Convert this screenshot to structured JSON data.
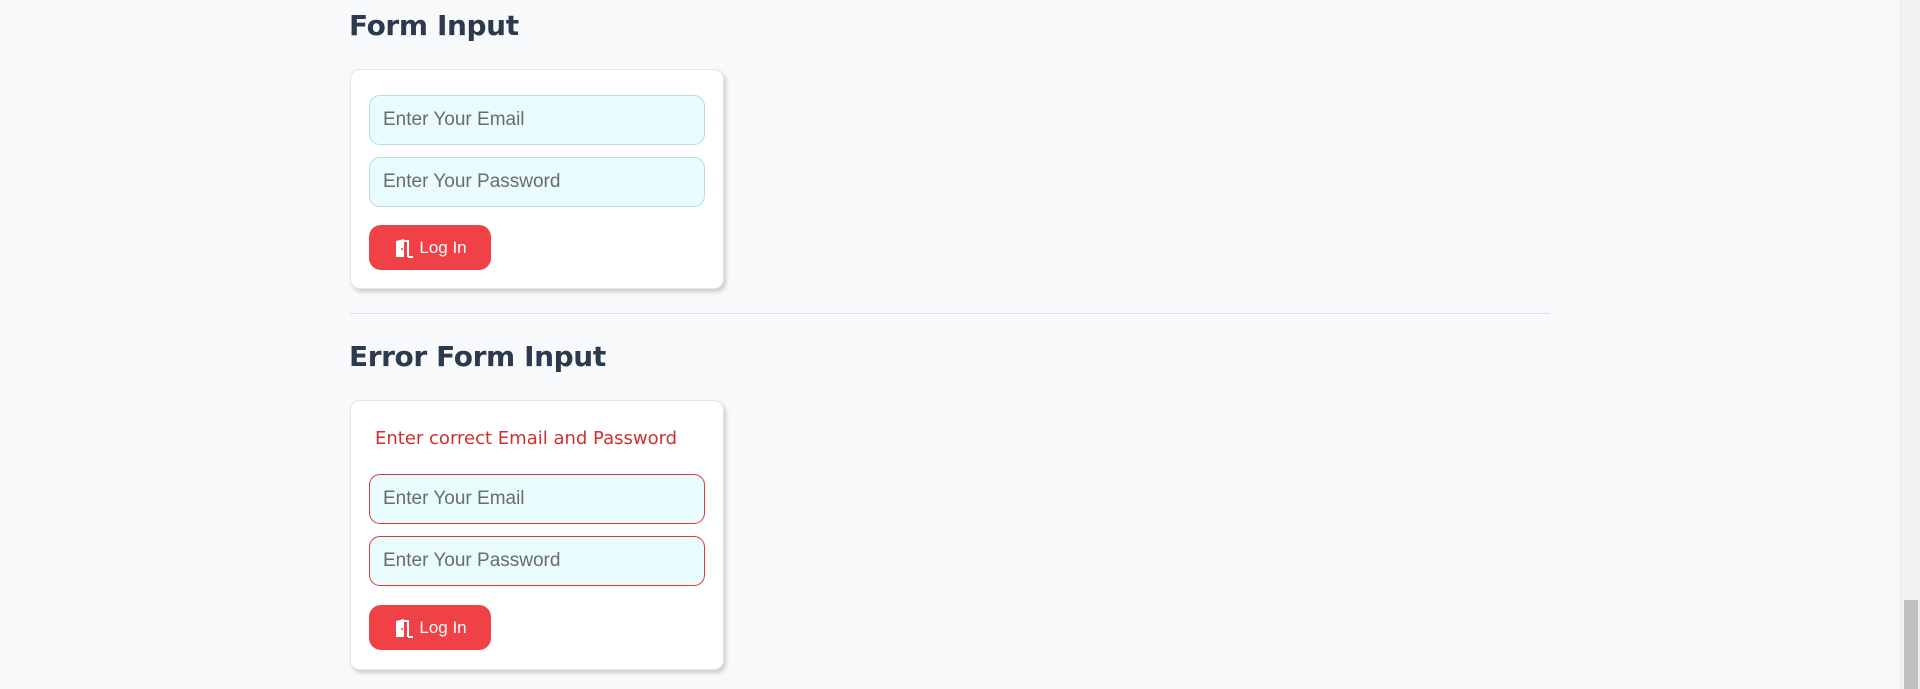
{
  "form_section": {
    "title": "Form Input",
    "email_placeholder": "Enter Your Email",
    "password_placeholder": "Enter Your Password",
    "login_label": "Log In",
    "login_icon": "door-exit-icon"
  },
  "error_section": {
    "title": "Error Form Input",
    "error_message": "Enter correct Email and Password",
    "email_placeholder": "Enter Your Email",
    "password_placeholder": "Enter Your Password",
    "login_label": "Log In",
    "login_icon": "door-exit-icon"
  },
  "colors": {
    "heading": "#2d3a4d",
    "button": "#ef4146",
    "error_text": "#d12f2f",
    "input_background": "#e8fcfd",
    "error_border": "#d83a3a"
  }
}
